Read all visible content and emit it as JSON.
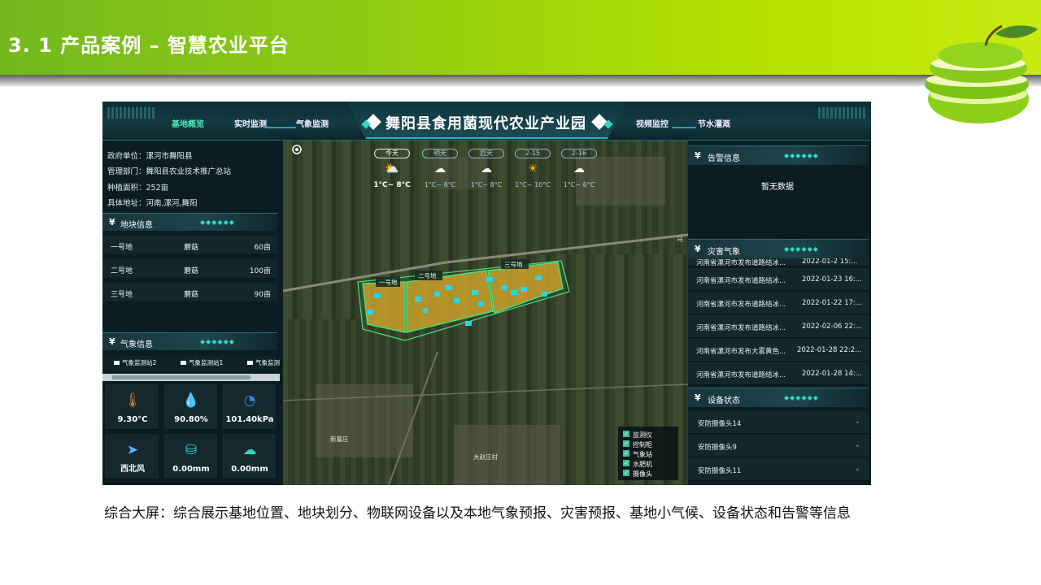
{
  "slide": {
    "title": "3. 1 产品案例 – 智慧农业平台",
    "caption": "综合大屏：综合展示基地位置、地块划分、物联网设备以及本地气象预报、灾害预报、基地小气候、设备状态和告警等信息"
  },
  "dashboard": {
    "title": "舞阳县食用菌现代农业产业园",
    "nav": [
      "基地概览",
      "实时监测",
      "气象监测",
      "视频监控",
      "节水灌溉"
    ],
    "active_nav": "基地概览",
    "base_info": [
      "政府单位：漯河市舞阳县",
      "管理部门：舞阳县农业技术推广总站",
      "种植面积：252亩",
      "具体地址：河南,漯河,舞阳"
    ],
    "plots_section": "地块信息",
    "plots": [
      {
        "name": "一号地",
        "crop": "蘑菇",
        "area": "60亩"
      },
      {
        "name": "二号地",
        "crop": "蘑菇",
        "area": "100亩"
      },
      {
        "name": "三号地",
        "crop": "蘑菇",
        "area": "90亩"
      }
    ],
    "weather_section": "气象信息",
    "stations": [
      "气象监测站2",
      "气象监测站1",
      "气象监测"
    ],
    "readings": [
      {
        "icon": "thermometer-icon",
        "value": "9.30°C"
      },
      {
        "icon": "humidity-icon",
        "value": "90.80%"
      },
      {
        "icon": "pressure-icon",
        "value": "101.40kPa"
      },
      {
        "icon": "wind-direction-icon",
        "value": "西北风"
      },
      {
        "icon": "rain-gauge-icon",
        "value": "0.00mm"
      },
      {
        "icon": "rainfall-icon",
        "value": "0.00mm"
      }
    ],
    "forecast": [
      {
        "day": "今天",
        "icon": "partly-cloudy-icon",
        "temp": "1°C~ 8°C"
      },
      {
        "day": "明天",
        "icon": "snow-icon",
        "temp": "1°C~ 8°C"
      },
      {
        "day": "后天",
        "icon": "snow-icon",
        "temp": "1°C~ 8°C"
      },
      {
        "day": "2-15",
        "icon": "sunny-icon",
        "temp": "1°C~ 10°C"
      },
      {
        "day": "2-16",
        "icon": "snow-icon",
        "temp": "1°C~ 6°C"
      }
    ],
    "map_labels": {
      "plot1": "一号地",
      "plot2": "二号地",
      "plot3": "三号地",
      "village1": "新墓庄",
      "village2": "大赵庄村",
      "road": "马"
    },
    "legend": [
      "监测仪",
      "控制柜",
      "气象站",
      "水肥机",
      "摄像头"
    ],
    "alert_section": "告警信息",
    "alert_empty": "暂无数据",
    "disaster_section": "灾害气象",
    "disasters": [
      {
        "text": "河南省漯河市发布道路结冰...",
        "time": "2022-01-2 15:..."
      },
      {
        "text": "河南省漯河市发布道路结冰...",
        "time": "2022-01-23 16:..."
      },
      {
        "text": "河南省漯河市发布道路结冰...",
        "time": "2022-01-22 17:..."
      },
      {
        "text": "河南省漯河市发布道路结冰...",
        "time": "2022-02-06 22:..."
      },
      {
        "text": "河南省漯河市发布大雾黄色...",
        "time": "2022-01-28 22:2..."
      },
      {
        "text": "河南省漯河市发布道路结冰...",
        "time": "2022-01-28 14:..."
      }
    ],
    "device_section": "设备状态",
    "devices": [
      {
        "name": "安防摄像头14",
        "status": "-"
      },
      {
        "name": "安防摄像头9",
        "status": "-"
      },
      {
        "name": "安防摄像头11",
        "status": "-"
      }
    ]
  },
  "colors": {
    "header_green": "#8fcb12",
    "accent_teal": "#2fd6c8",
    "plot_yellow": "#c9a12a"
  }
}
